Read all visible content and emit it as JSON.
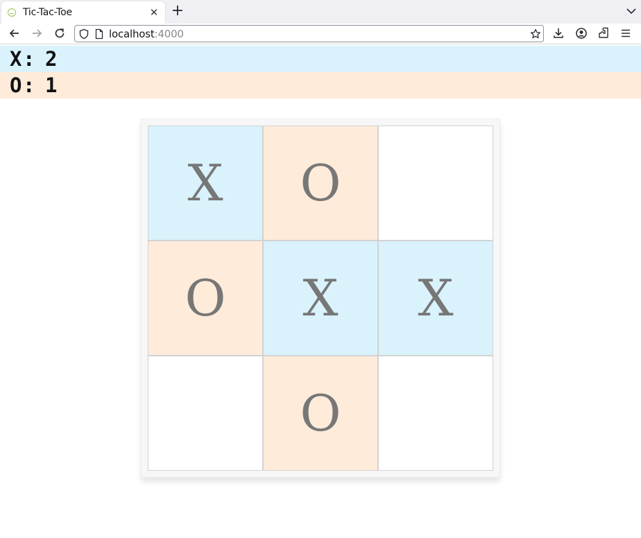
{
  "browser": {
    "tab_title": "Tic-Tac-Toe",
    "close_glyph": "✕",
    "new_tab_glyph": "+",
    "url_host": "localhost",
    "url_port": ":4000"
  },
  "scoreboard": {
    "x": {
      "label": "X",
      "colon": ":",
      "value": "2"
    },
    "o": {
      "label": "O",
      "colon": ":",
      "value": "1"
    }
  },
  "board": {
    "cells": [
      "X",
      "O",
      "",
      "O",
      "X",
      "X",
      "",
      "O",
      ""
    ]
  },
  "colors": {
    "x_background": "#d9f2fc",
    "o_background": "#ffebd9",
    "mark_color": "#777777"
  }
}
